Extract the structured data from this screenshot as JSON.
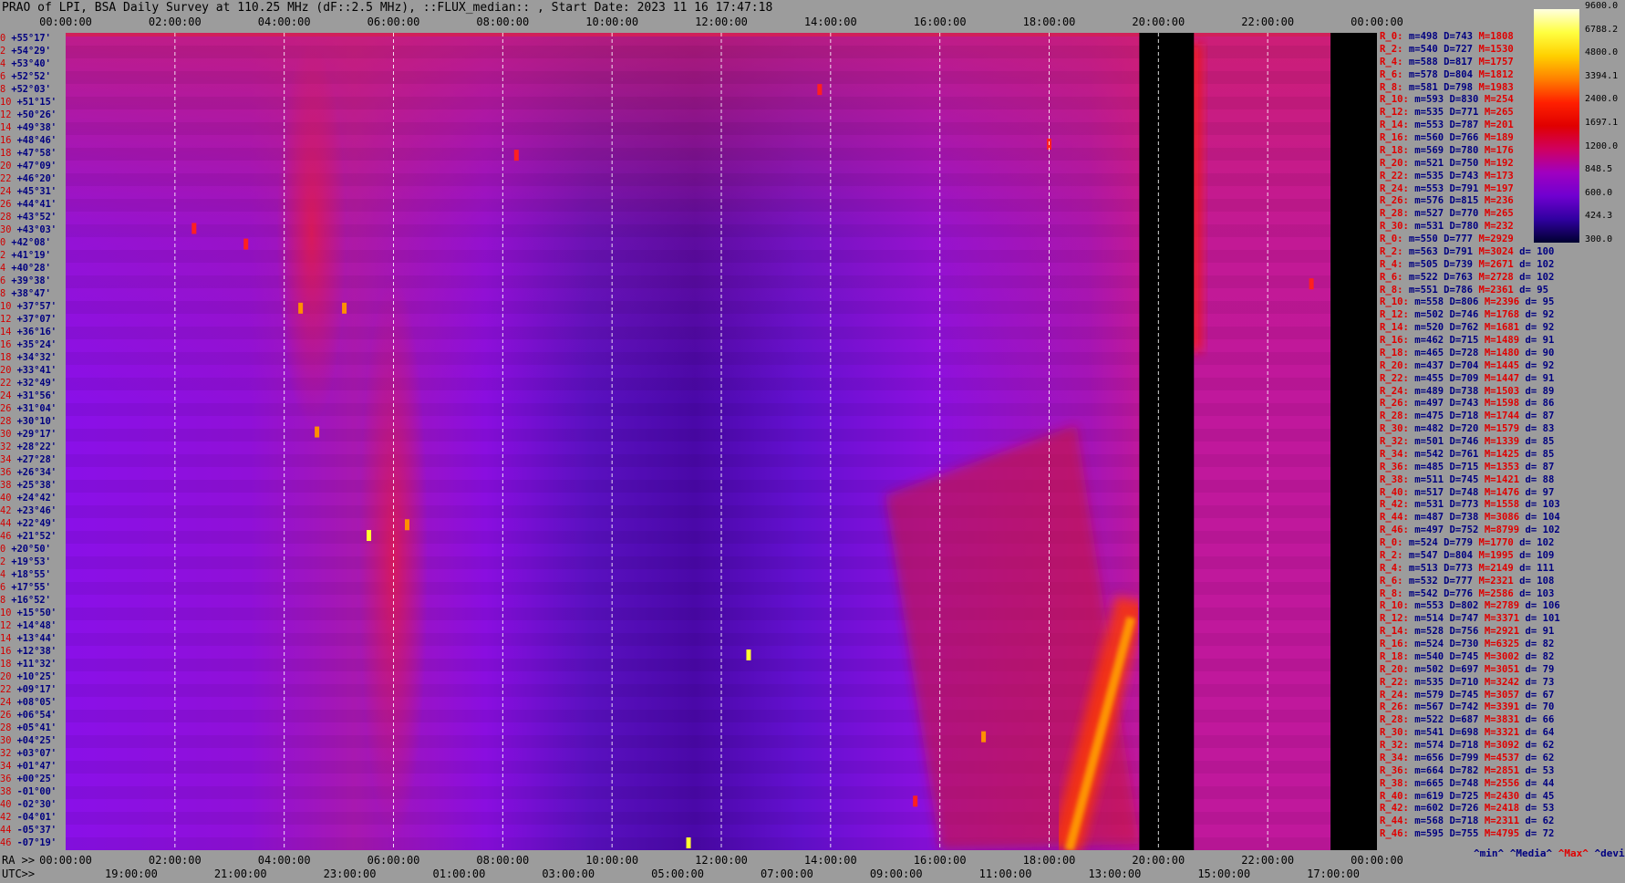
{
  "title": "PRAO of LPI, BSA Daily Survey at 110.25 MHz (dF::2.5 MHz), ::FLUX_median:: , Start Date: 2023 11 16 17:47:18",
  "chart_data": {
    "type": "heatmap",
    "title": "PRAO of LPI, BSA Daily Survey at 110.25 MHz (dF::2.5 MHz), ::FLUX_median:: , Start Date: 2023 11 16 17:47:18",
    "x_top_ticks": [
      "00:00:00",
      "02:00:00",
      "04:00:00",
      "06:00:00",
      "08:00:00",
      "10:00:00",
      "12:00:00",
      "14:00:00",
      "16:00:00",
      "18:00:00",
      "20:00:00",
      "22:00:00",
      "00:00:00"
    ],
    "x_bottom_ra_prefix": "RA >>",
    "x_bottom_ra_ticks": [
      "00:00:00",
      "02:00:00",
      "04:00:00",
      "06:00:00",
      "08:00:00",
      "10:00:00",
      "12:00:00",
      "14:00:00",
      "16:00:00",
      "18:00:00",
      "20:00:00",
      "22:00:00",
      "00:00:00"
    ],
    "x_bottom_utc_prefix": "UTC>>",
    "x_bottom_utc_ticks": [
      "19:00:00",
      "21:00:00",
      "23:00:00",
      "01:00:00",
      "03:00:00",
      "05:00:00",
      "07:00:00",
      "09:00:00",
      "11:00:00",
      "13:00:00",
      "15:00:00",
      "17:00:00"
    ],
    "x_range_hours_ra": [
      0,
      24
    ],
    "y_labels": [
      "+55°17'",
      "+54°29'",
      "+53°40'",
      "+52°52'",
      "+52°03'",
      "+51°15'",
      "+50°26'",
      "+49°38'",
      "+48°46'",
      "+47°58'",
      "+47°09'",
      "+46°20'",
      "+45°31'",
      "+44°41'",
      "+43°52'",
      "+43°03'",
      "+42°08'",
      "+41°19'",
      "+40°28'",
      "+39°38'",
      "+38°47'",
      "+37°57'",
      "+37°07'",
      "+36°16'",
      "+35°24'",
      "+34°32'",
      "+33°41'",
      "+32°49'",
      "+31°56'",
      "+31°04'",
      "+30°10'",
      "+29°17'",
      "+28°22'",
      "+27°28'",
      "+26°34'",
      "+25°38'",
      "+24°42'",
      "+23°46'",
      "+22°49'",
      "+21°52'",
      "+20°50'",
      "+19°53'",
      "+18°55'",
      "+17°55'",
      "+16°52'",
      "+15°50'",
      "+14°48'",
      "+13°44'",
      "+12°38'",
      "+11°32'",
      "+10°25'",
      "+09°17'",
      "+08°05'",
      "+06°54'",
      "+05°41'",
      "+04°25'",
      "+03°07'",
      "+01°47'",
      "+00°25'",
      "-01°00'",
      "-02°30'",
      "-04°01'",
      "-05°37'",
      "-07°19'"
    ],
    "y_index_labels": [
      "0",
      "2",
      "4",
      "6",
      "8",
      "10",
      "12",
      "14",
      "16",
      "18",
      "20",
      "22",
      "24",
      "26",
      "28",
      "30",
      "0",
      "2",
      "4",
      "6",
      "8",
      "10",
      "12",
      "14",
      "16",
      "18",
      "20",
      "22",
      "24",
      "26",
      "28",
      "30",
      "32",
      "34",
      "36",
      "38",
      "40",
      "42",
      "44",
      "46",
      "0",
      "2",
      "4",
      "6",
      "8",
      "10",
      "12",
      "14",
      "16",
      "18",
      "20",
      "22",
      "24",
      "26",
      "28",
      "30",
      "32",
      "34",
      "36",
      "38",
      "40",
      "42",
      "44",
      "46"
    ],
    "colorbar": {
      "labels": [
        "9600.0",
        "6788.2",
        "4800.0",
        "3394.1",
        "2400.0",
        "1697.1",
        "1200.0",
        "848.5",
        "600.0",
        "424.3",
        "300.0"
      ],
      "colors": [
        "#ffffe0",
        "#ffff40",
        "#ffd000",
        "#ff8000",
        "#ff2000",
        "#e00000",
        "#d00060",
        "#a000c0",
        "#7000d0",
        "#3000a0",
        "#000030"
      ]
    },
    "grid": "vertical dashed lines at every 2 h RA",
    "blanked_ra_hours": [
      [
        19.65,
        20.65
      ],
      [
        23.15,
        24.2
      ]
    ],
    "features": [
      {
        "kind": "bright-source-diagonal",
        "ra_from": 18.3,
        "ra_to": 19.5,
        "dec_from": -7.3,
        "dec_to": 17.0
      },
      {
        "kind": "galactic-plane-band",
        "ra_center": 20.3,
        "dec_from": 35,
        "dec_to": 55
      },
      {
        "kind": "warm-column",
        "ra_center": 4.5,
        "dec_from": 30,
        "dec_to": 55
      },
      {
        "kind": "warm-column",
        "ra_center": 6.0,
        "dec_from": -7,
        "dec_to": 40
      }
    ],
    "sources": [
      {
        "ra": 5.55,
        "dec": 22.0,
        "level": "yellow"
      },
      {
        "ra": 6.25,
        "dec": 22.8,
        "level": "orange"
      },
      {
        "ra": 12.5,
        "dec": 12.4,
        "level": "yellow"
      },
      {
        "ra": 11.4,
        "dec": -7.2,
        "level": "yellow"
      },
      {
        "ra": 4.6,
        "dec": 29.5,
        "level": "orange"
      },
      {
        "ra": 5.1,
        "dec": 37.9,
        "level": "orange"
      },
      {
        "ra": 4.3,
        "dec": 37.9,
        "level": "orange"
      },
      {
        "ra": 3.3,
        "dec": 42.1,
        "level": "red"
      },
      {
        "ra": 2.35,
        "dec": 43.2,
        "level": "red"
      },
      {
        "ra": 16.8,
        "dec": 4.9,
        "level": "orange"
      },
      {
        "ra": 15.55,
        "dec": -2.0,
        "level": "red"
      },
      {
        "ra": 18.0,
        "dec": 48.6,
        "level": "red"
      },
      {
        "ra": 13.8,
        "dec": 52.1,
        "level": "red"
      },
      {
        "ra": 8.25,
        "dec": 47.9,
        "level": "red"
      },
      {
        "ra": 22.8,
        "dec": 39.5,
        "level": "red"
      }
    ]
  },
  "stats": {
    "rows": [
      {
        "label": "R_0:",
        "m": "m=498",
        "D": "D=743",
        "M": "M=1808",
        "d": ""
      },
      {
        "label": "R_2:",
        "m": "m=540",
        "D": "D=727",
        "M": "M=1530",
        "d": ""
      },
      {
        "label": "R_4:",
        "m": "m=588",
        "D": "D=817",
        "M": "M=1757",
        "d": ""
      },
      {
        "label": "R_6:",
        "m": "m=578",
        "D": "D=804",
        "M": "M=1812",
        "d": ""
      },
      {
        "label": "R_8:",
        "m": "m=581",
        "D": "D=798",
        "M": "M=1983",
        "d": ""
      },
      {
        "label": "R_10:",
        "m": "m=593",
        "D": "D=830",
        "M": "M=254",
        "d": ""
      },
      {
        "label": "R_12:",
        "m": "m=535",
        "D": "D=771",
        "M": "M=265",
        "d": ""
      },
      {
        "label": "R_14:",
        "m": "m=553",
        "D": "D=787",
        "M": "M=201",
        "d": ""
      },
      {
        "label": "R_16:",
        "m": "m=560",
        "D": "D=766",
        "M": "M=189",
        "d": ""
      },
      {
        "label": "R_18:",
        "m": "m=569",
        "D": "D=780",
        "M": "M=176",
        "d": ""
      },
      {
        "label": "R_20:",
        "m": "m=521",
        "D": "D=750",
        "M": "M=192",
        "d": ""
      },
      {
        "label": "R_22:",
        "m": "m=535",
        "D": "D=743",
        "M": "M=173",
        "d": ""
      },
      {
        "label": "R_24:",
        "m": "m=553",
        "D": "D=791",
        "M": "M=197",
        "d": ""
      },
      {
        "label": "R_26:",
        "m": "m=576",
        "D": "D=815",
        "M": "M=236",
        "d": ""
      },
      {
        "label": "R_28:",
        "m": "m=527",
        "D": "D=770",
        "M": "M=265",
        "d": ""
      },
      {
        "label": "R_30:",
        "m": "m=531",
        "D": "D=780",
        "M": "M=232",
        "d": ""
      },
      {
        "label": "R_0:",
        "m": "m=550",
        "D": "D=777",
        "M": "M=2929",
        "d": ""
      },
      {
        "label": "R_2:",
        "m": "m=563",
        "D": "D=791",
        "M": "M=3024",
        "d": "d= 100"
      },
      {
        "label": "R_4:",
        "m": "m=505",
        "D": "D=739",
        "M": "M=2671",
        "d": "d= 102"
      },
      {
        "label": "R_6:",
        "m": "m=522",
        "D": "D=763",
        "M": "M=2728",
        "d": "d= 102"
      },
      {
        "label": "R_8:",
        "m": "m=551",
        "D": "D=786",
        "M": "M=2361",
        "d": "d= 95"
      },
      {
        "label": "R_10:",
        "m": "m=558",
        "D": "D=806",
        "M": "M=2396",
        "d": "d= 95"
      },
      {
        "label": "R_12:",
        "m": "m=502",
        "D": "D=746",
        "M": "M=1768",
        "d": "d= 92"
      },
      {
        "label": "R_14:",
        "m": "m=520",
        "D": "D=762",
        "M": "M=1681",
        "d": "d= 92"
      },
      {
        "label": "R_16:",
        "m": "m=462",
        "D": "D=715",
        "M": "M=1489",
        "d": "d= 91"
      },
      {
        "label": "R_18:",
        "m": "m=465",
        "D": "D=728",
        "M": "M=1480",
        "d": "d= 90"
      },
      {
        "label": "R_20:",
        "m": "m=437",
        "D": "D=704",
        "M": "M=1445",
        "d": "d= 92"
      },
      {
        "label": "R_22:",
        "m": "m=455",
        "D": "D=709",
        "M": "M=1447",
        "d": "d= 91"
      },
      {
        "label": "R_24:",
        "m": "m=489",
        "D": "D=738",
        "M": "M=1503",
        "d": "d= 89"
      },
      {
        "label": "R_26:",
        "m": "m=497",
        "D": "D=743",
        "M": "M=1598",
        "d": "d= 86"
      },
      {
        "label": "R_28:",
        "m": "m=475",
        "D": "D=718",
        "M": "M=1744",
        "d": "d= 87"
      },
      {
        "label": "R_30:",
        "m": "m=482",
        "D": "D=720",
        "M": "M=1579",
        "d": "d= 83"
      },
      {
        "label": "R_32:",
        "m": "m=501",
        "D": "D=746",
        "M": "M=1339",
        "d": "d= 85"
      },
      {
        "label": "R_34:",
        "m": "m=542",
        "D": "D=761",
        "M": "M=1425",
        "d": "d= 85"
      },
      {
        "label": "R_36:",
        "m": "m=485",
        "D": "D=715",
        "M": "M=1353",
        "d": "d= 87"
      },
      {
        "label": "R_38:",
        "m": "m=511",
        "D": "D=745",
        "M": "M=1421",
        "d": "d= 88"
      },
      {
        "label": "R_40:",
        "m": "m=517",
        "D": "D=748",
        "M": "M=1476",
        "d": "d= 97"
      },
      {
        "label": "R_42:",
        "m": "m=531",
        "D": "D=773",
        "M": "M=1558",
        "d": "d= 103"
      },
      {
        "label": "R_44:",
        "m": "m=487",
        "D": "D=738",
        "M": "M=3086",
        "d": "d= 104"
      },
      {
        "label": "R_46:",
        "m": "m=497",
        "D": "D=752",
        "M": "M=8799",
        "d": "d= 102"
      },
      {
        "label": "R_0:",
        "m": "m=524",
        "D": "D=779",
        "M": "M=1770",
        "d": "d= 102"
      },
      {
        "label": "R_2:",
        "m": "m=547",
        "D": "D=804",
        "M": "M=1995",
        "d": "d= 109"
      },
      {
        "label": "R_4:",
        "m": "m=513",
        "D": "D=773",
        "M": "M=2149",
        "d": "d= 111"
      },
      {
        "label": "R_6:",
        "m": "m=532",
        "D": "D=777",
        "M": "M=2321",
        "d": "d= 108"
      },
      {
        "label": "R_8:",
        "m": "m=542",
        "D": "D=776",
        "M": "M=2586",
        "d": "d= 103"
      },
      {
        "label": "R_10:",
        "m": "m=553",
        "D": "D=802",
        "M": "M=2789",
        "d": "d= 106"
      },
      {
        "label": "R_12:",
        "m": "m=514",
        "D": "D=747",
        "M": "M=3371",
        "d": "d= 101"
      },
      {
        "label": "R_14:",
        "m": "m=528",
        "D": "D=756",
        "M": "M=2921",
        "d": "d= 91"
      },
      {
        "label": "R_16:",
        "m": "m=524",
        "D": "D=730",
        "M": "M=6325",
        "d": "d= 82"
      },
      {
        "label": "R_18:",
        "m": "m=540",
        "D": "D=745",
        "M": "M=3002",
        "d": "d= 82"
      },
      {
        "label": "R_20:",
        "m": "m=502",
        "D": "D=697",
        "M": "M=3051",
        "d": "d= 79"
      },
      {
        "label": "R_22:",
        "m": "m=535",
        "D": "D=710",
        "M": "M=3242",
        "d": "d= 73"
      },
      {
        "label": "R_24:",
        "m": "m=579",
        "D": "D=745",
        "M": "M=3057",
        "d": "d= 67"
      },
      {
        "label": "R_26:",
        "m": "m=567",
        "D": "D=742",
        "M": "M=3391",
        "d": "d= 70"
      },
      {
        "label": "R_28:",
        "m": "m=522",
        "D": "D=687",
        "M": "M=3831",
        "d": "d= 66"
      },
      {
        "label": "R_30:",
        "m": "m=541",
        "D": "D=698",
        "M": "M=3321",
        "d": "d= 64"
      },
      {
        "label": "R_32:",
        "m": "m=574",
        "D": "D=718",
        "M": "M=3092",
        "d": "d= 62"
      },
      {
        "label": "R_34:",
        "m": "m=656",
        "D": "D=799",
        "M": "M=4537",
        "d": "d= 62"
      },
      {
        "label": "R_36:",
        "m": "m=664",
        "D": "D=782",
        "M": "M=2851",
        "d": "d= 53"
      },
      {
        "label": "R_38:",
        "m": "m=665",
        "D": "D=748",
        "M": "M=2556",
        "d": "d= 44"
      },
      {
        "label": "R_40:",
        "m": "m=619",
        "D": "D=725",
        "M": "M=2430",
        "d": "d= 45"
      },
      {
        "label": "R_42:",
        "m": "m=602",
        "D": "D=726",
        "M": "M=2418",
        "d": "d= 53"
      },
      {
        "label": "R_44:",
        "m": "m=568",
        "D": "D=718",
        "M": "M=2311",
        "d": "d= 62"
      },
      {
        "label": "R_46:",
        "m": "m=595",
        "D": "D=755",
        "M": "M=4795",
        "d": "d= 72"
      }
    ],
    "footer": {
      "min": "^min^",
      "median": "^Media^",
      "max": "^Max^",
      "devia": "^devia^"
    }
  }
}
